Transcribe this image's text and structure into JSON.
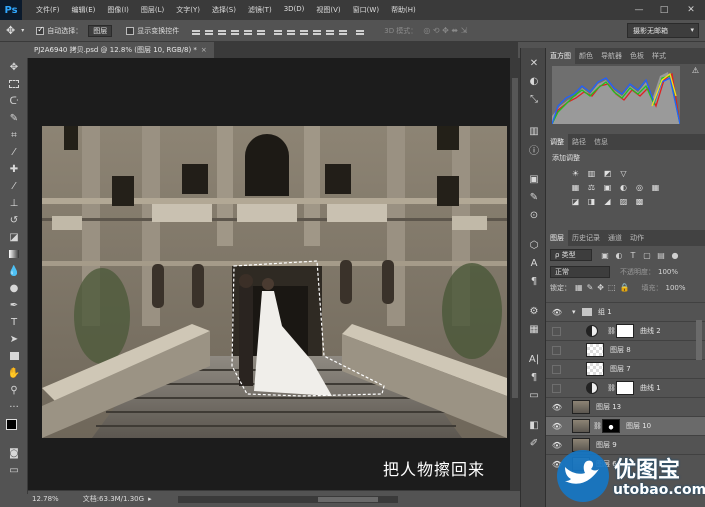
{
  "app": {
    "logo": "Ps",
    "menu": [
      "文件(F)",
      "编辑(E)",
      "图像(I)",
      "图层(L)",
      "文字(Y)",
      "选择(S)",
      "滤镜(T)",
      "3D(D)",
      "视图(V)",
      "窗口(W)",
      "帮助(H)"
    ],
    "window_controls": [
      "—",
      "□",
      "✕"
    ]
  },
  "options_bar": {
    "auto_select_label": "自动选择：",
    "auto_select_checked": true,
    "auto_select_target": "图层",
    "show_transform_label": "显示变换控件",
    "show_transform_checked": false,
    "mode_3d_label": "3D 模式：",
    "workspace": "摄影无邮箱"
  },
  "document": {
    "tab_title": "PJ2A6940 拷贝.psd @ 12.8% (图层 10, RGB/8) *",
    "close_icon": "×",
    "caption": "把人物擦回来"
  },
  "status": {
    "zoom": "12.78%",
    "doc_size": "文档:63.3M/1.30G"
  },
  "panels": {
    "top_tabs": [
      "直方图",
      "颜色",
      "导航器",
      "色板",
      "样式"
    ],
    "mid_tabs": [
      "调整",
      "路径",
      "信息"
    ],
    "adjust_label": "添加调整",
    "adjust_icons_row1": [
      "☀",
      "▥",
      "◩",
      "▽"
    ],
    "adjust_icons_row2": [
      "▦",
      "⚖",
      "▣",
      "◐",
      "◎",
      "▦"
    ],
    "adjust_icons_row3": [
      "◪",
      "◨",
      "◢",
      "▨",
      "▩"
    ],
    "layer_tabs": [
      "图层",
      "历史记录",
      "通道",
      "动作"
    ],
    "filter_label": "ρ 类型",
    "blend_mode": "正常",
    "opacity_label": "不透明度：",
    "opacity": "100%",
    "lock_label": "锁定：",
    "fill_label": "填充：",
    "fill": "100%"
  },
  "layers": [
    {
      "name": "组 1",
      "kind": "group",
      "visible": true,
      "indent": 0
    },
    {
      "name": "曲线 2",
      "kind": "adjust",
      "visible": false,
      "indent": 1
    },
    {
      "name": "图层 8",
      "kind": "pixel",
      "visible": false,
      "indent": 1
    },
    {
      "name": "图层 7",
      "kind": "pixel",
      "visible": false,
      "indent": 1
    },
    {
      "name": "曲线 1",
      "kind": "adjust",
      "visible": false,
      "indent": 1
    },
    {
      "name": "图层 13",
      "kind": "pixel",
      "visible": true,
      "indent": 0
    },
    {
      "name": "图层 10",
      "kind": "masked",
      "visible": true,
      "indent": 0,
      "active": true
    },
    {
      "name": "图层 9",
      "kind": "pixel",
      "visible": true,
      "indent": 0
    },
    {
      "name": "图层 6",
      "kind": "pixel",
      "visible": true,
      "indent": 0
    }
  ],
  "watermark": {
    "title": "优图宝",
    "url": "utobao.com"
  },
  "colors": {
    "menubar": "#3a3a3a",
    "panel": "#535353",
    "canvas_bg": "#1c1c1c",
    "accent_blue": "#31a8ff"
  }
}
